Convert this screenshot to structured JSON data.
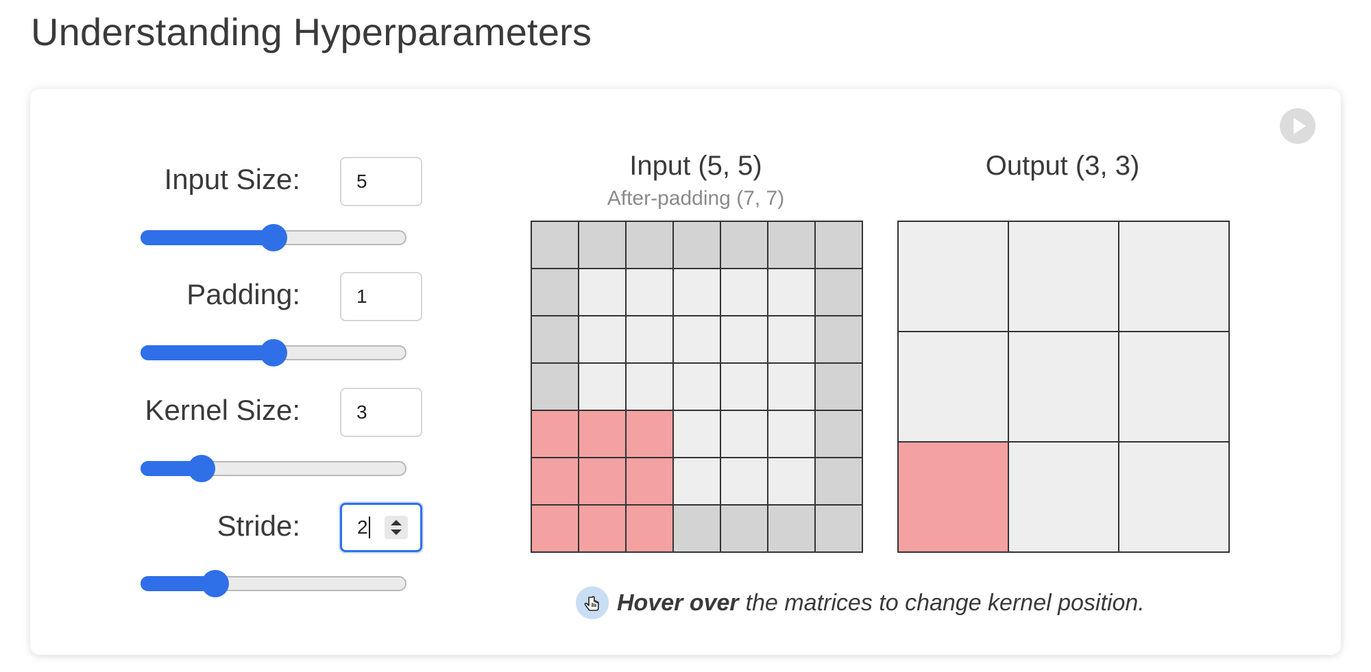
{
  "page": {
    "title": "Understanding Hyperparameters"
  },
  "controls": {
    "input_size": {
      "label": "Input Size:",
      "value": "5",
      "slider_level": 0.5
    },
    "padding": {
      "label": "Padding:",
      "value": "1",
      "slider_level": 0.5
    },
    "kernel_size": {
      "label": "Kernel Size:",
      "value": "3",
      "slider_level": 0.23
    },
    "stride": {
      "label": "Stride:",
      "value": "2",
      "slider_level": 0.28
    }
  },
  "input_matrix": {
    "title": "Input (5, 5)",
    "subtitle": "After-padding (7, 7)",
    "size": 7,
    "padding": 1,
    "kernel_size": 3,
    "highlight_row": 4,
    "highlight_col": 0
  },
  "output_matrix": {
    "title": "Output (3, 3)",
    "size": 3,
    "highlight_row": 2,
    "highlight_col": 0
  },
  "hint": {
    "bold": "Hover over",
    "rest": "the matrices to change kernel position."
  },
  "colors": {
    "accent": "#2f6fe8",
    "highlight": "#f4a1a2",
    "padding_cell": "#d3d3d3",
    "cell": "#eeeeee"
  },
  "icons": {
    "play": "play-icon",
    "hint": "hand-pointer-icon",
    "spinner": "spinner-arrows-icon"
  }
}
